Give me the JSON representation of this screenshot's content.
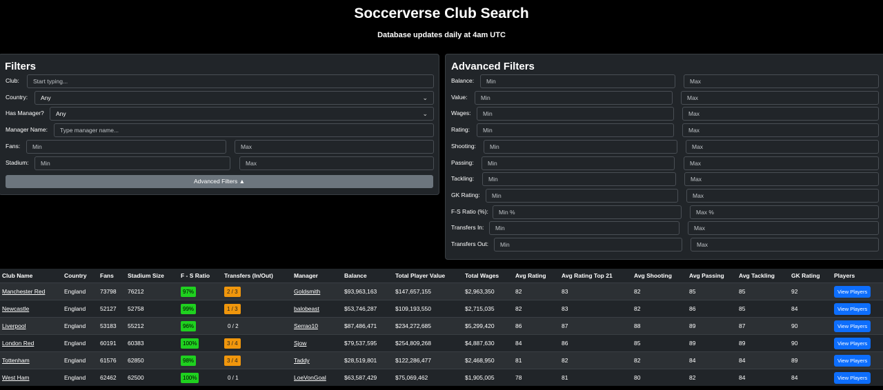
{
  "page": {
    "title": "Soccerverse Club Search",
    "subtitle": "Database updates daily at 4am UTC"
  },
  "filters": {
    "title": "Filters",
    "club_label": "Club:",
    "club_placeholder": "Start typing...",
    "country_label": "Country:",
    "country_value": "Any",
    "has_manager_label": "Has Manager?",
    "has_manager_value": "Any",
    "manager_name_label": "Manager Name:",
    "manager_name_placeholder": "Type manager name...",
    "fans_label": "Fans:",
    "stadium_label": "Stadium:",
    "min_placeholder": "Min",
    "max_placeholder": "Max",
    "advanced_button": "Advanced Filters ▲"
  },
  "advanced": {
    "title": "Advanced Filters",
    "rows": [
      {
        "label": "Balance:",
        "min": "Min",
        "max": "Max"
      },
      {
        "label": "Value:",
        "min": "Min",
        "max": "Max"
      },
      {
        "label": "Wages:",
        "min": "Min",
        "max": "Max"
      },
      {
        "label": "Rating:",
        "min": "Min",
        "max": "Max"
      },
      {
        "label": "Shooting:",
        "min": "Min",
        "max": "Max"
      },
      {
        "label": "Passing:",
        "min": "Min",
        "max": "Max"
      },
      {
        "label": "Tackling:",
        "min": "Min",
        "max": "Max"
      },
      {
        "label": "GK Rating:",
        "min": "Min",
        "max": "Max"
      },
      {
        "label": "F-S Ratio (%):",
        "min": "Min %",
        "max": "Max %"
      },
      {
        "label": "Transfers In:",
        "min": "Min",
        "max": "Max"
      },
      {
        "label": "Transfers Out:",
        "min": "Min",
        "max": "Max"
      }
    ]
  },
  "table": {
    "headers": [
      "Club Name",
      "Country",
      "Fans",
      "Stadium Size",
      "F - S Ratio",
      "Transfers (In/Out)",
      "Manager",
      "Balance",
      "Total Player Value",
      "Total Wages",
      "Avg Rating",
      "Avg Rating Top 21",
      "Avg Shooting",
      "Avg Passing",
      "Avg Tackling",
      "GK Rating",
      "Players"
    ],
    "view_label": "View Players",
    "rows": [
      {
        "club": "Manchester Red",
        "country": "England",
        "fans": "73798",
        "stadium": "76212",
        "ratio": "97%",
        "transfers": "2 / 3",
        "transfers_highlight": true,
        "manager": "Goldsmith",
        "balance": "$93,963,163",
        "value": "$147,657,155",
        "wages": "$2,963,350",
        "avg": "82",
        "top21": "83",
        "shooting": "82",
        "passing": "85",
        "tackling": "85",
        "gk": "92"
      },
      {
        "club": "Newcastle",
        "country": "England",
        "fans": "52127",
        "stadium": "52758",
        "ratio": "99%",
        "transfers": "1 / 3",
        "transfers_highlight": true,
        "manager": "balobeast",
        "balance": "$53,746,287",
        "value": "$109,193,550",
        "wages": "$2,715,035",
        "avg": "82",
        "top21": "83",
        "shooting": "82",
        "passing": "86",
        "tackling": "85",
        "gk": "84"
      },
      {
        "club": "Liverpool",
        "country": "England",
        "fans": "53183",
        "stadium": "55212",
        "ratio": "96%",
        "transfers": "0 / 2",
        "transfers_highlight": false,
        "manager": "Serrao10",
        "balance": "$87,486,471",
        "value": "$234,272,685",
        "wages": "$5,299,420",
        "avg": "86",
        "top21": "87",
        "shooting": "88",
        "passing": "89",
        "tackling": "87",
        "gk": "90"
      },
      {
        "club": "London Red",
        "country": "England",
        "fans": "60191",
        "stadium": "60383",
        "ratio": "100%",
        "transfers": "3 / 4",
        "transfers_highlight": true,
        "manager": "Sjow",
        "balance": "$79,537,595",
        "value": "$254,809,268",
        "wages": "$4,887,630",
        "avg": "84",
        "top21": "86",
        "shooting": "85",
        "passing": "89",
        "tackling": "89",
        "gk": "90"
      },
      {
        "club": "Tottenham",
        "country": "England",
        "fans": "61576",
        "stadium": "62850",
        "ratio": "98%",
        "transfers": "3 / 4",
        "transfers_highlight": true,
        "manager": "Taddy",
        "balance": "$28,519,801",
        "value": "$122,286,477",
        "wages": "$2,468,950",
        "avg": "81",
        "top21": "82",
        "shooting": "82",
        "passing": "84",
        "tackling": "84",
        "gk": "89"
      },
      {
        "club": "West Ham",
        "country": "England",
        "fans": "62462",
        "stadium": "62500",
        "ratio": "100%",
        "transfers": "0 / 1",
        "transfers_highlight": false,
        "manager": "LoeVonGoal",
        "balance": "$63,587,429",
        "value": "$75,069,462",
        "wages": "$1,905,005",
        "avg": "78",
        "top21": "81",
        "shooting": "80",
        "passing": "82",
        "tackling": "84",
        "gk": "84"
      }
    ]
  }
}
